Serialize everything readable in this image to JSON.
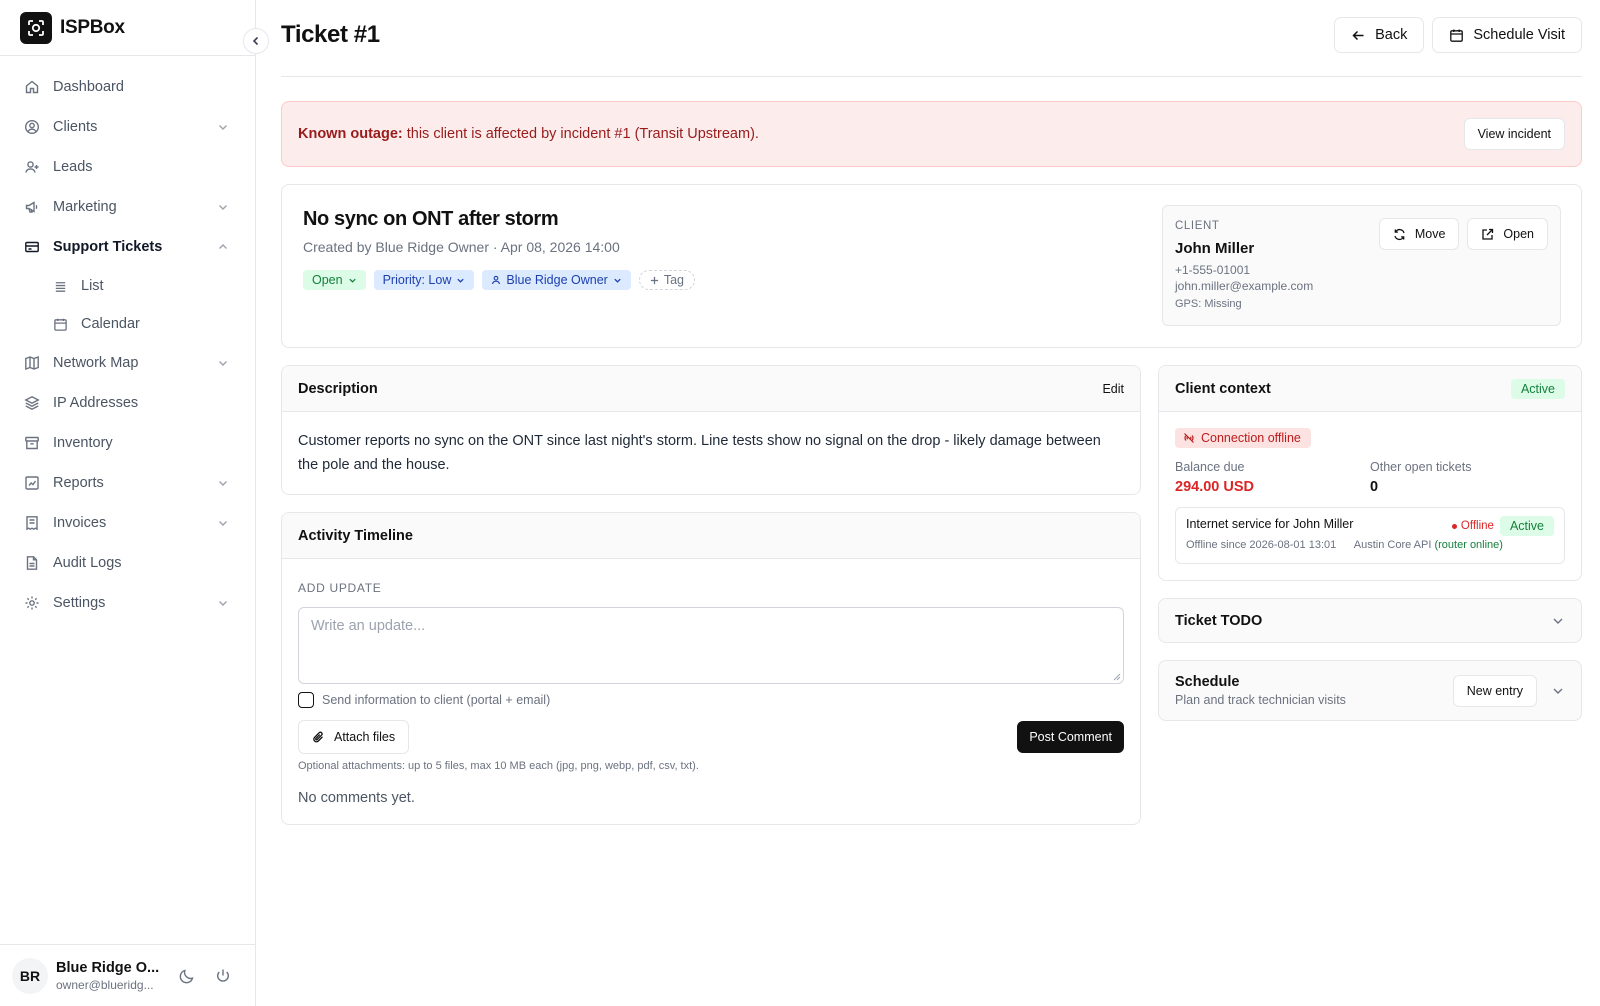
{
  "brand": {
    "name": "ISPBox"
  },
  "sidebar": {
    "items": [
      {
        "label": "Dashboard",
        "icon": "home-icon"
      },
      {
        "label": "Clients",
        "icon": "user-circle-icon"
      },
      {
        "label": "Leads",
        "icon": "user-plus-icon"
      },
      {
        "label": "Marketing",
        "icon": "megaphone-icon"
      },
      {
        "label": "Support Tickets",
        "icon": "ticket-icon"
      },
      {
        "label": "List",
        "icon": "list-icon"
      },
      {
        "label": "Calendar",
        "icon": "calendar-icon"
      },
      {
        "label": "Network Map",
        "icon": "map-icon"
      },
      {
        "label": "IP Addresses",
        "icon": "layers-icon"
      },
      {
        "label": "Inventory",
        "icon": "archive-icon"
      },
      {
        "label": "Reports",
        "icon": "report-icon"
      },
      {
        "label": "Invoices",
        "icon": "receipt-icon"
      },
      {
        "label": "Audit Logs",
        "icon": "file-icon"
      },
      {
        "label": "Settings",
        "icon": "gear-icon"
      }
    ]
  },
  "user": {
    "initials": "BR",
    "name": "Blue Ridge O...",
    "email": "owner@blueridg..."
  },
  "header": {
    "title": "Ticket #1",
    "back_label": "Back",
    "schedule_label": "Schedule Visit"
  },
  "alert": {
    "strong": "Known outage:",
    "text": " this client is affected by incident #1 (Transit Upstream).",
    "button": "View incident"
  },
  "ticket": {
    "title": "No sync on ONT after storm",
    "meta": "Created by Blue Ridge Owner · Apr 08, 2026 14:00",
    "status": "Open",
    "priority": "Priority: Low",
    "assignee": "Blue Ridge Owner",
    "add_tag": "Tag"
  },
  "client": {
    "label": "CLIENT",
    "name": "John Miller",
    "phone": "+1-555-01001",
    "email": "john.miller@example.com",
    "gps": "GPS: Missing",
    "move_label": "Move",
    "open_label": "Open"
  },
  "description": {
    "title": "Description",
    "edit_label": "Edit",
    "text": "Customer reports no sync on the ONT since last night's storm. Line tests show no signal on the drop - likely damage between the pole and the house."
  },
  "timeline": {
    "title": "Activity Timeline",
    "add_update": "ADD UPDATE",
    "placeholder": "Write an update...",
    "notify_label": "Send information to client (portal + email)",
    "attach_label": "Attach files",
    "post_label": "Post Comment",
    "attach_note": "Optional attachments: up to 5 files, max 10 MB each (jpg, png, webp, pdf, csv, txt).",
    "empty": "No comments yet."
  },
  "context": {
    "title": "Client context",
    "status": "Active",
    "connection": "Connection offline",
    "balance_label": "Balance due",
    "balance_value": "294.00 USD",
    "other_label": "Other open tickets",
    "other_value": "0",
    "service_name": "Internet service for John Miller",
    "service_state": "Offline",
    "service_status": "Active",
    "offline_since": "Offline since 2026-08-01 13:01",
    "router_api": "Austin Core API",
    "router_state": "(router online)"
  },
  "todo": {
    "title": "Ticket TODO"
  },
  "schedule": {
    "title": "Schedule",
    "subtitle": "Plan and track technician visits",
    "new_entry": "New entry"
  }
}
